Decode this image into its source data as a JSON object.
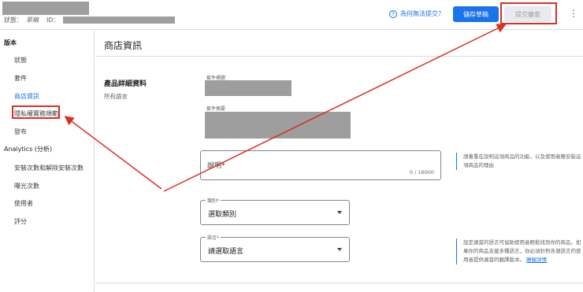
{
  "header": {
    "status_label": "狀態：",
    "status_value": "草稿",
    "id_label": "ID：",
    "help_text": "為何無法提交？",
    "help_icon": "help-circle-icon",
    "save_label": "儲存草稿",
    "submit_label": "提交審查",
    "more_icon": "more-vert-icon"
  },
  "sidebar": {
    "section_version": "版本",
    "items": [
      {
        "label": "狀態"
      },
      {
        "label": "套件"
      },
      {
        "label": "商店資訊"
      },
      {
        "label": "隱私權實務規範"
      },
      {
        "label": "發布"
      }
    ],
    "section_analytics": "Analytics (分析)",
    "analytics_items": [
      {
        "label": "安裝次數和解除安裝次數"
      },
      {
        "label": "曝光次數"
      },
      {
        "label": "使用者"
      },
      {
        "label": "評分"
      }
    ]
  },
  "main": {
    "page_title": "商店資訊",
    "section_title": "產品詳細資料",
    "section_subtitle": "所有語言",
    "package_title_label": "套件標題",
    "package_summary_label": "套件摘要",
    "description_label": "說明*",
    "description_counter": "0 / 16000",
    "description_hint": "請著重在說明這項商品的功能，以及使用者應安裝這項商品的理由",
    "category_label": "類別*",
    "category_value": "選取類別",
    "language_label": "語言*",
    "language_value": "請選取語言",
    "language_hint": "設定適當的語言可協助使用者輕鬆找到你的商品。如果你的商品支援多種語言，你必須針對各個語言的使用者提供適當的翻譯版本。",
    "language_hint_link": "瞭解詳情"
  },
  "colors": {
    "accent": "#1a73e8",
    "annotation": "#d93025",
    "redacted": "#9e9e9e"
  }
}
